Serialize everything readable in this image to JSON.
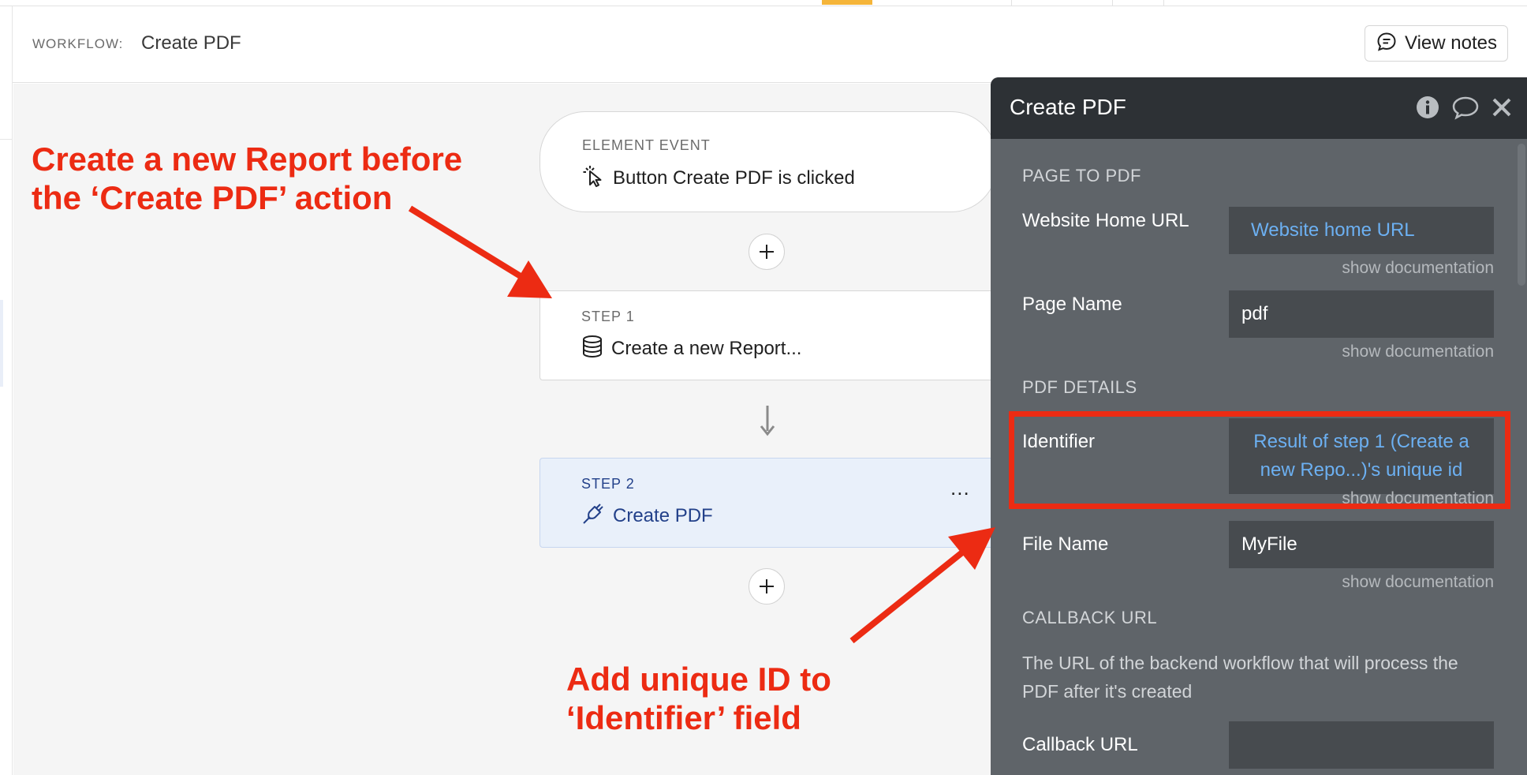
{
  "header": {
    "workflow_label": "WORKFLOW:",
    "workflow_name": "Create PDF",
    "view_notes_label": "View notes"
  },
  "workflow": {
    "event": {
      "kicker": "ELEMENT EVENT",
      "title": "Button Create PDF is clicked",
      "icon": "cursor-click-icon"
    },
    "steps": [
      {
        "kicker": "STEP 1",
        "title": "Create a new Report...",
        "icon": "database-icon",
        "active": false
      },
      {
        "kicker": "STEP 2",
        "title": "Create PDF",
        "icon": "plug-icon",
        "active": true,
        "more": "..."
      }
    ]
  },
  "panel": {
    "title": "Create PDF",
    "icons": [
      "info-icon",
      "comment-icon",
      "close-icon"
    ],
    "sections": {
      "page_to_pdf": "PAGE TO PDF",
      "pdf_details": "PDF DETAILS",
      "callback_url": "CALLBACK URL"
    },
    "fields": {
      "website_home_url": {
        "label": "Website Home URL",
        "value": "Website home URL"
      },
      "page_name": {
        "label": "Page Name",
        "value": "pdf"
      },
      "identifier": {
        "label": "Identifier",
        "value": "Result of step 1 (Create a new Repo...)'s unique id"
      },
      "file_name": {
        "label": "File Name",
        "value": "MyFile"
      },
      "callback_url": {
        "label": "Callback URL",
        "value": ""
      }
    },
    "show_documentation": "show documentation",
    "callback_help": "The URL of the backend workflow that will process the PDF after it's created"
  },
  "annotations": {
    "note1_line1": "Create a new Report before",
    "note1_line2": "the ‘Create PDF’ action",
    "note2_line1": "Add unique ID to",
    "note2_line2": "‘Identifier’ field",
    "color": "#ec2b13"
  },
  "colors": {
    "panel_bg": "#5f6469",
    "panel_header": "#2d3135",
    "input_bg": "#474b4f",
    "dynamic_text": "#6cb0f2",
    "active_step_bg": "#e9f0fa",
    "active_step_text": "#23418a"
  }
}
